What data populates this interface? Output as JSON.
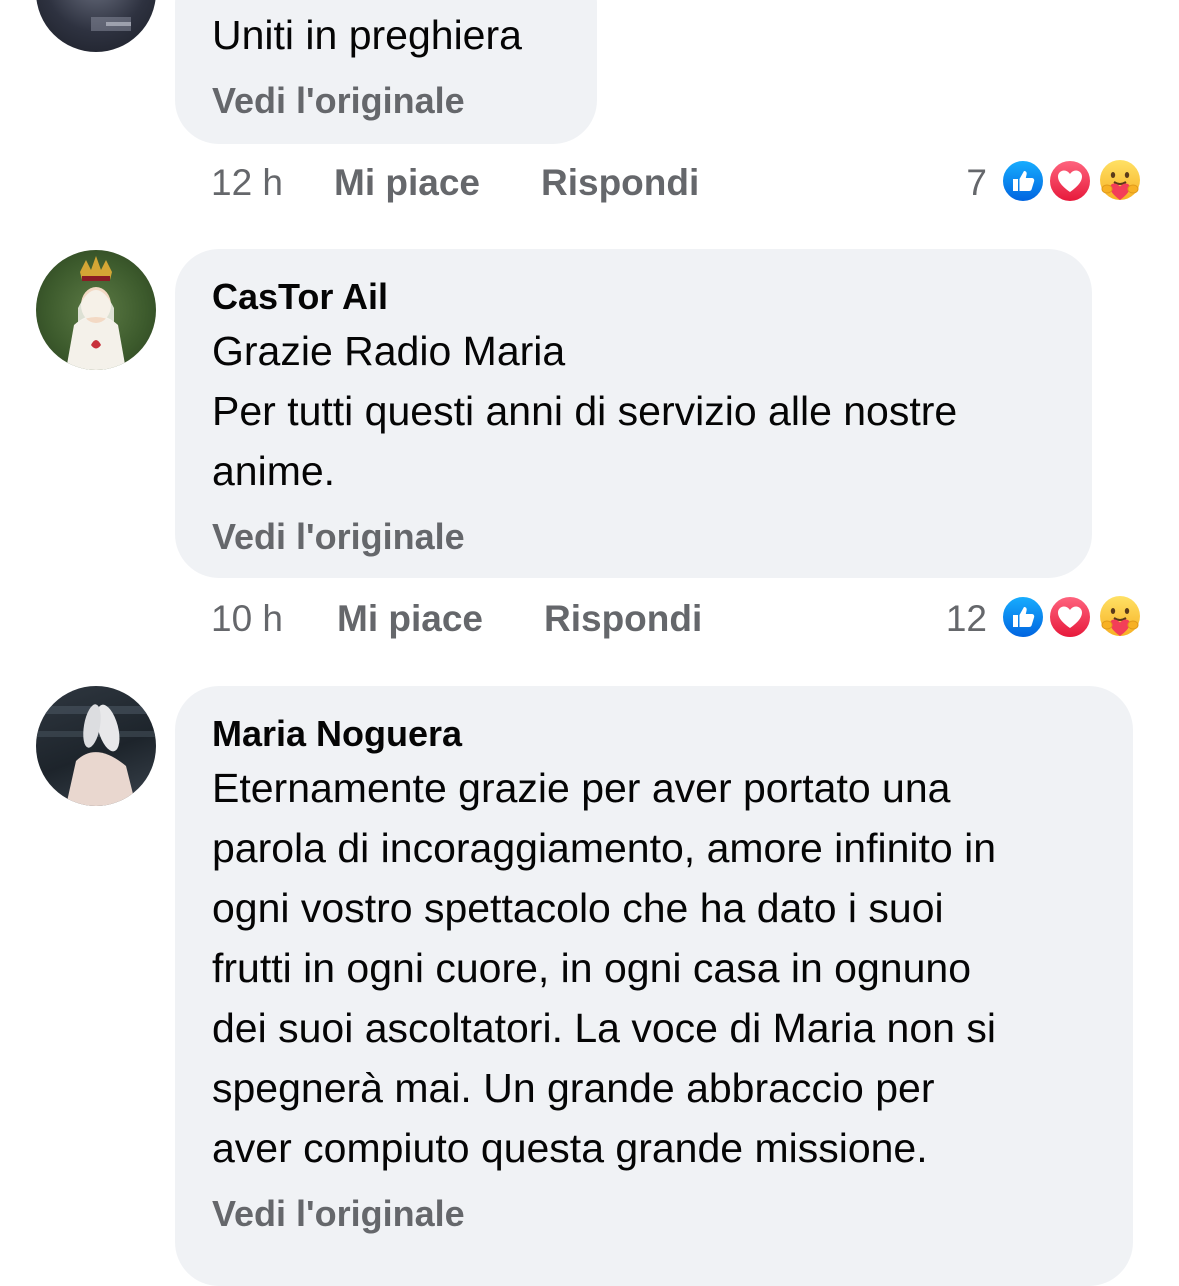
{
  "comments": [
    {
      "author": "",
      "lines": [
        "Uniti in preghiera"
      ],
      "see_original": "Vedi l'originale",
      "time": "12 h",
      "like_label": "Mi piace",
      "reply_label": "Rispondi",
      "reaction_count": "7",
      "reactions": [
        "like-icon",
        "love-icon",
        "care-icon"
      ]
    },
    {
      "author": "CasTor Ail",
      "lines": [
        "Grazie Radio Maria",
        "Per tutti questi anni di servizio alle nostre",
        "anime."
      ],
      "see_original": "Vedi l'originale",
      "time": "10 h",
      "like_label": "Mi piace",
      "reply_label": "Rispondi",
      "reaction_count": "12",
      "reactions": [
        "like-icon",
        "love-icon",
        "care-icon"
      ]
    },
    {
      "author": "Maria Noguera",
      "lines": [
        "Eternamente grazie per aver portato una",
        "parola di incoraggiamento, amore infinito in",
        "ogni vostro spettacolo che ha dato i suoi",
        "frutti in ogni cuore, in ogni casa in ognuno",
        "dei suoi ascoltatori. La voce di Maria non si",
        "spegnerà mai. Un grande abbraccio per",
        "aver compiuto questa grande missione."
      ],
      "see_original": "Vedi l'originale"
    }
  ],
  "colors": {
    "bubble": "#f0f2f5",
    "secondary_text": "#65676b",
    "like_blue": "#1877f2",
    "love_red": "#f33e58",
    "care_yellow": "#f7b125"
  }
}
